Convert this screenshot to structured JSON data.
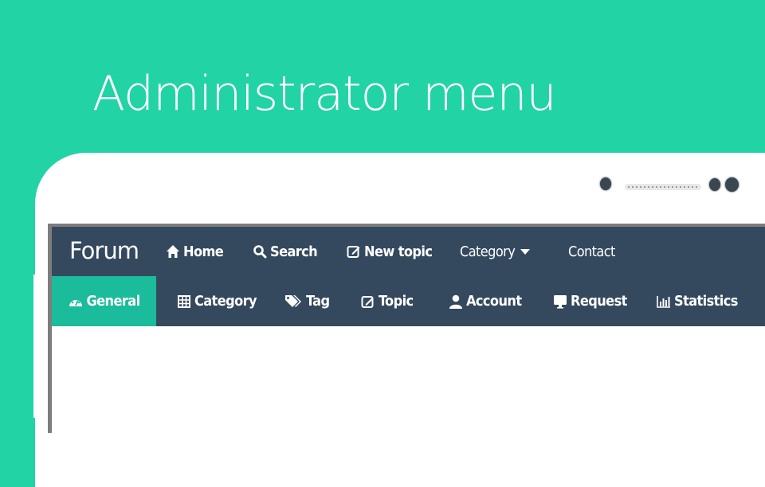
{
  "slide": {
    "title": "Administrator menu"
  },
  "colors": {
    "background": "#22d3a6",
    "navbar": "#34495e",
    "active": "#1abc9c"
  },
  "navbar": {
    "brand": "Forum",
    "items": [
      {
        "label": "Home",
        "icon": "home-icon"
      },
      {
        "label": "Search",
        "icon": "search-icon"
      },
      {
        "label": "New topic",
        "icon": "edit-icon"
      },
      {
        "label": "Category",
        "icon": "caret-down-icon"
      },
      {
        "label": "Contact"
      }
    ]
  },
  "admin_menu": {
    "items": [
      {
        "label": "General",
        "icon": "dashboard-icon",
        "active": true
      },
      {
        "label": "Category",
        "icon": "grid-icon"
      },
      {
        "label": "Tag",
        "icon": "tags-icon"
      },
      {
        "label": "Topic",
        "icon": "edit-icon"
      },
      {
        "label": "Account",
        "icon": "user-icon"
      },
      {
        "label": "Request",
        "icon": "monitor-icon"
      },
      {
        "label": "Statistics",
        "icon": "bar-chart-icon"
      }
    ]
  }
}
